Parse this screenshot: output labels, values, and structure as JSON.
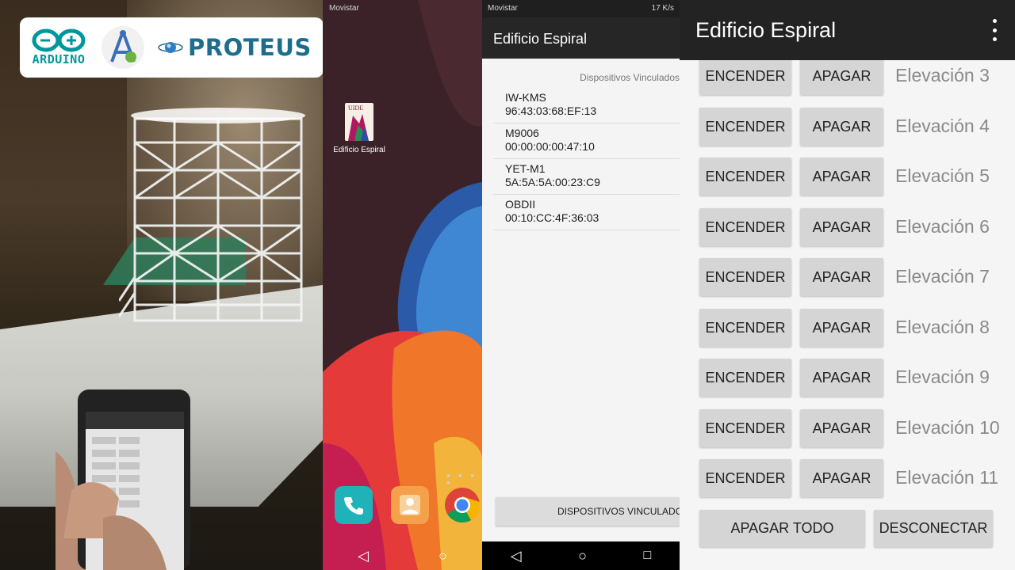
{
  "logos": {
    "arduino_text": "ARDUINO",
    "proteus_text": "PROTEUS"
  },
  "home": {
    "status_carrier": "Movistar",
    "app_label": "Edificio Espiral",
    "app_icon_text": "UIDE"
  },
  "devices_screen": {
    "status_carrier": "Movistar",
    "status_right": "17 K/s",
    "title": "Edificio Espiral",
    "list_title": "Dispositivos Vinculados",
    "devices": [
      {
        "name": "IW-KMS",
        "mac": "96:43:03:68:EF:13"
      },
      {
        "name": "M9006",
        "mac": "00:00:00:00:47:10"
      },
      {
        "name": "YET-M1",
        "mac": "5A:5A:5A:00:23:C9"
      },
      {
        "name": "OBDII",
        "mac": "00:10:CC:4F:36:03"
      }
    ],
    "bottom_button": "DISPOSITIVOS VINCULADOS"
  },
  "control_screen": {
    "title": "Edificio Espiral",
    "on_label": "ENCENDER",
    "off_label": "APAGAR",
    "rows": [
      {
        "label": "Elevación 3"
      },
      {
        "label": "Elevación 4"
      },
      {
        "label": "Elevación 5"
      },
      {
        "label": "Elevación 6"
      },
      {
        "label": "Elevación 7"
      },
      {
        "label": "Elevación 8"
      },
      {
        "label": "Elevación 9"
      },
      {
        "label": "Elevación 10"
      },
      {
        "label": "Elevación 11"
      }
    ],
    "off_all": "APAGAR TODO",
    "disconnect": "DESCONECTAR"
  }
}
